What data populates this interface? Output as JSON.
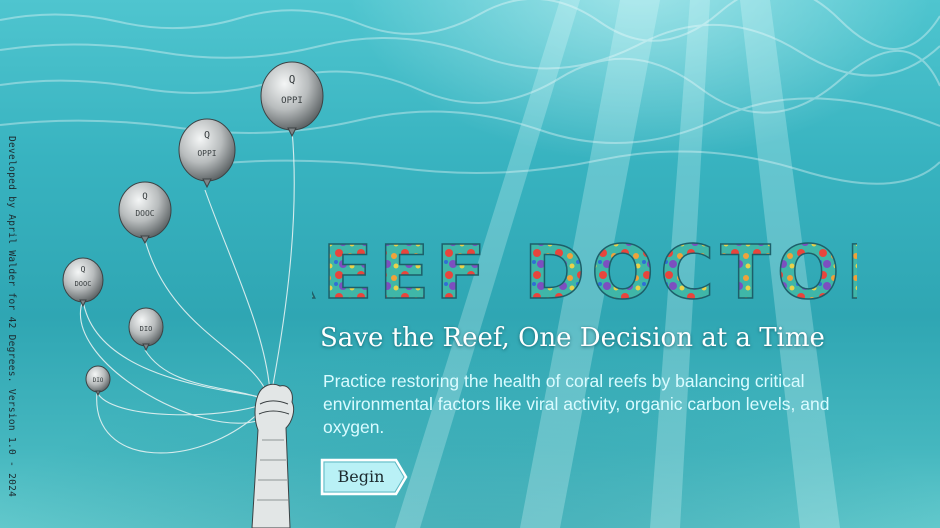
{
  "game": {
    "title": "REEF DOCTOR",
    "subtitle": "Save the Reef, One Decision at a Time",
    "description": "Practice restoring the health of coral reefs by balancing critical environmental factors like viral activity, organic carbon levels, and oxygen.",
    "begin_label": "Begin",
    "credit": "Developed by April Walder for 42 Degrees. Version 1.0 - 2024"
  },
  "balloon_labels": [
    "OPPI",
    "OPPI",
    "DOOC",
    "DOOC",
    "DIO",
    "DIO"
  ],
  "colors": {
    "water_top": "#4fc5cf",
    "water_mid": "#2fa6b3",
    "title_coral": [
      "#e8453c",
      "#3fb6a8",
      "#f0a23a",
      "#7c4fc0",
      "#e9d24a"
    ],
    "button_fill": "#b9f1f6",
    "subtitle": "#ffffff",
    "description": "#d9fbff"
  }
}
